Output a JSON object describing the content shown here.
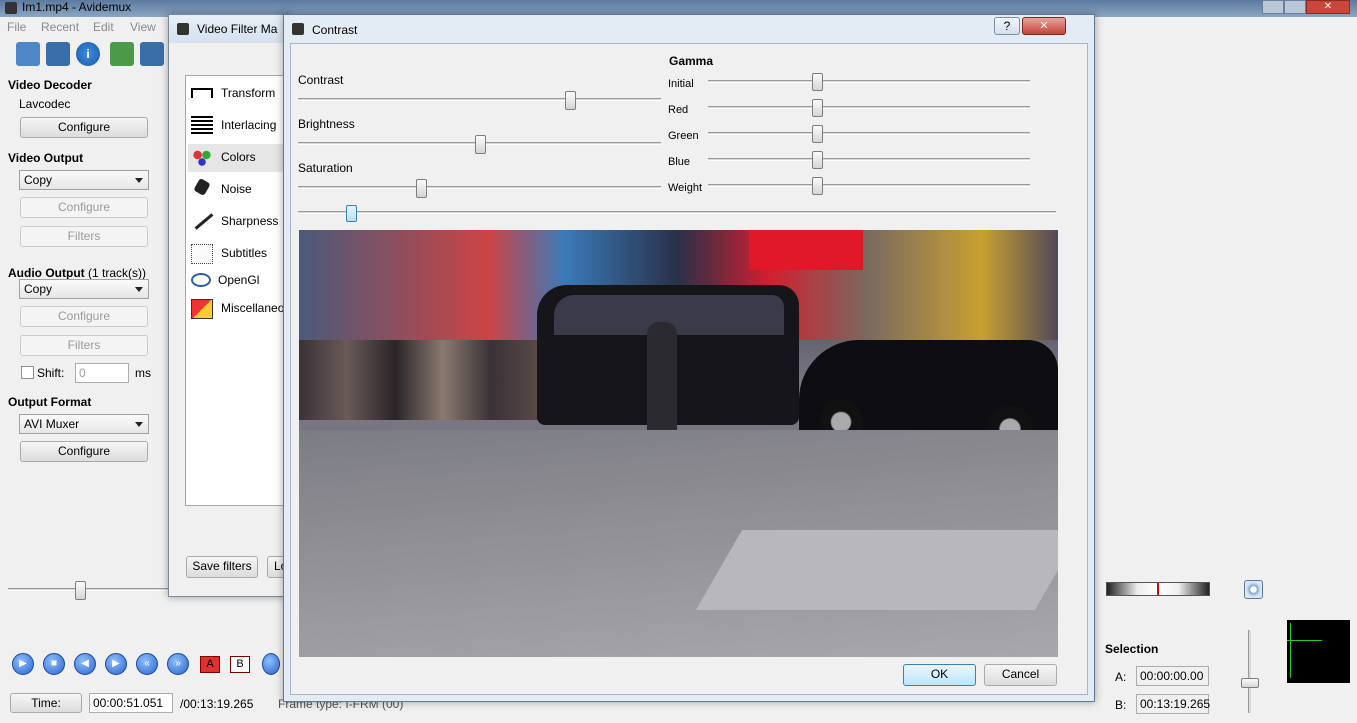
{
  "main": {
    "title": "Im1.mp4 - Avidemux",
    "menu": [
      "File",
      "Recent",
      "Edit",
      "View"
    ],
    "toolbar_icons": [
      "open-folder-icon",
      "save-icon",
      "info-icon",
      "open-image-icon",
      "save-copy-icon"
    ]
  },
  "left_panel": {
    "video_decoder": {
      "heading": "Video Decoder",
      "codec": "Lavcodec",
      "configure": "Configure"
    },
    "video_output": {
      "heading": "Video Output",
      "selected": "Copy",
      "configure": "Configure",
      "filters": "Filters"
    },
    "audio_output": {
      "heading": "Audio Output",
      "tracks": "(1 track(s))",
      "selected": "Copy",
      "configure": "Configure",
      "filters": "Filters",
      "shift_label": "Shift:",
      "shift_value": "0",
      "shift_unit": "ms"
    },
    "output_format": {
      "heading": "Output Format",
      "selected": "AVI Muxer",
      "configure": "Configure"
    }
  },
  "bottom": {
    "time_button": "Time:",
    "current_time": "00:00:51.051",
    "total_time": "/00:13:19.265",
    "frame_type": "Frame type:  I-FRM (00)",
    "selection": {
      "heading": "Selection",
      "a_label": "A:",
      "a_value": "00:00:00.00",
      "b_label": "B:",
      "b_value": "00:13:19.265"
    },
    "marker_a": "A",
    "marker_b": "B"
  },
  "filter_manager": {
    "title": "Video Filter Manager",
    "title_visible": "Video Filter Ma",
    "categories": [
      {
        "label": "Transform",
        "icon": "transform-icon"
      },
      {
        "label": "Interlacing",
        "icon": "interlacing-icon"
      },
      {
        "label": "Colors",
        "icon": "colors-icon"
      },
      {
        "label": "Noise",
        "icon": "noise-icon"
      },
      {
        "label": "Sharpness",
        "icon": "sharpness-icon"
      },
      {
        "label": "Subtitles",
        "icon": "subtitles-icon"
      },
      {
        "label": "OpenGl",
        "icon": "opengl-icon"
      },
      {
        "label": "Miscellaneous",
        "icon": "miscellaneous-icon"
      }
    ],
    "misc_visible": "Miscellaneo",
    "save_filters": "Save filters",
    "load_visible": "Lo",
    "selected_index": 2
  },
  "contrast_dialog": {
    "title": "Contrast",
    "help": "?",
    "close": "✕",
    "sliders": [
      {
        "label": "Contrast",
        "value": 0.75
      },
      {
        "label": "Brightness",
        "value": 0.5
      },
      {
        "label": "Saturation",
        "value": 0.34
      }
    ],
    "gamma": {
      "heading": "Gamma",
      "sliders": [
        {
          "label": "Initial",
          "value": 0.34
        },
        {
          "label": "Red",
          "value": 0.34
        },
        {
          "label": "Green",
          "value": 0.34
        },
        {
          "label": "Blue",
          "value": 0.34
        },
        {
          "label": "Weight",
          "value": 0.34
        }
      ]
    },
    "preview_position": 0.07,
    "ok": "OK",
    "cancel": "Cancel"
  }
}
